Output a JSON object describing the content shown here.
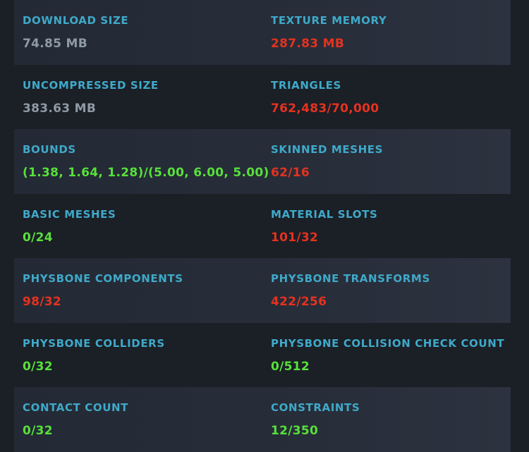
{
  "colors": {
    "label": "#3fa9c9",
    "neutral_value": "#8f9aa5",
    "over_limit_value": "#e5321f",
    "within_limit_value": "#58e03b",
    "background": "#1b1f26"
  },
  "stats": [
    {
      "left": {
        "label": "DOWNLOAD SIZE",
        "value": "74.85 MB",
        "status": "neutral"
      },
      "right": {
        "label": "TEXTURE MEMORY",
        "value": "287.83 MB",
        "status": "bad"
      }
    },
    {
      "left": {
        "label": "UNCOMPRESSED SIZE",
        "value": "383.63 MB",
        "status": "neutral"
      },
      "right": {
        "label": "TRIANGLES",
        "value": "762,483/70,000",
        "status": "bad"
      }
    },
    {
      "left": {
        "label": "BOUNDS",
        "value": "(1.38, 1.64, 1.28)/(5.00, 6.00, 5.00)",
        "status": "good"
      },
      "right": {
        "label": "SKINNED MESHES",
        "value": "62/16",
        "status": "bad"
      }
    },
    {
      "left": {
        "label": "BASIC MESHES",
        "value": "0/24",
        "status": "good"
      },
      "right": {
        "label": "MATERIAL SLOTS",
        "value": "101/32",
        "status": "bad"
      }
    },
    {
      "left": {
        "label": "PHYSBONE COMPONENTS",
        "value": "98/32",
        "status": "bad"
      },
      "right": {
        "label": "PHYSBONE TRANSFORMS",
        "value": "422/256",
        "status": "bad"
      }
    },
    {
      "left": {
        "label": "PHYSBONE COLLIDERS",
        "value": "0/32",
        "status": "good"
      },
      "right": {
        "label": "PHYSBONE COLLISION CHECK COUNT",
        "value": "0/512",
        "status": "good"
      }
    },
    {
      "left": {
        "label": "CONTACT COUNT",
        "value": "0/32",
        "status": "good"
      },
      "right": {
        "label": "CONSTRAINTS",
        "value": "12/350",
        "status": "good"
      }
    }
  ]
}
